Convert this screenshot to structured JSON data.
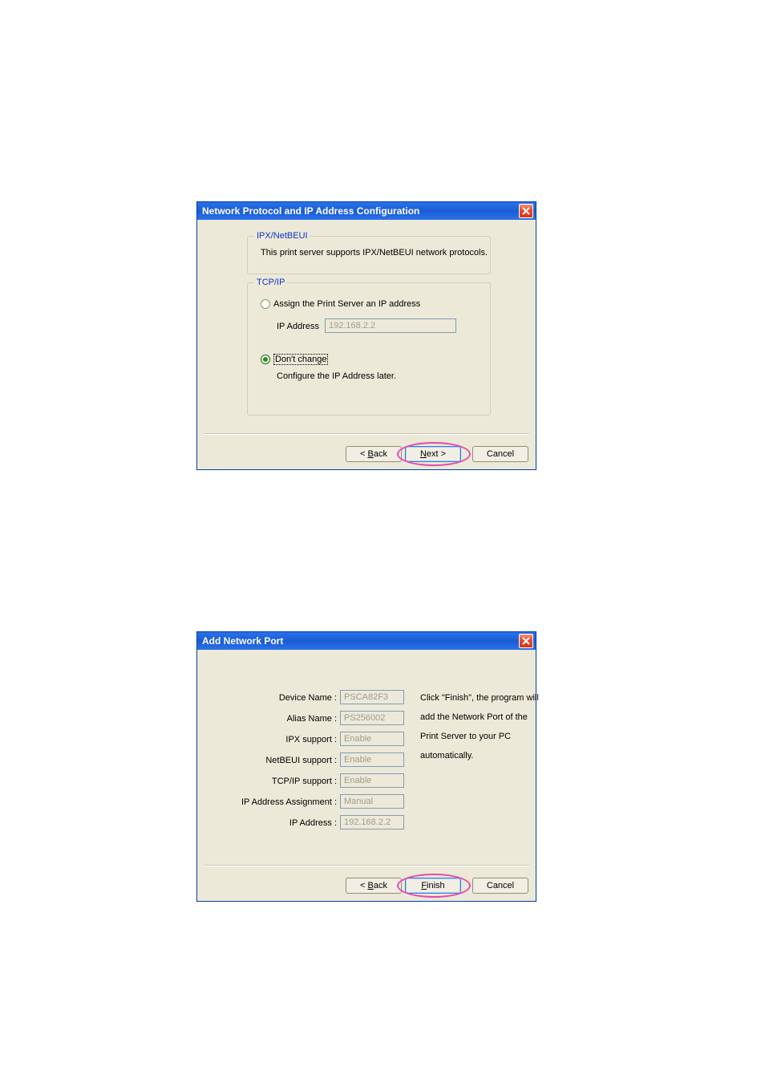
{
  "dialog1": {
    "title": "Network Protocol and IP Address Configuration",
    "ipxGroup": {
      "legend": "IPX/NetBEUI",
      "description": "This print server supports IPX/NetBEUI network protocols."
    },
    "tcpGroup": {
      "legend": "TCP/IP",
      "radioAssign": "Assign the Print Server an IP address",
      "ipLabel": "IP Address",
      "ipValue": "192.168.2.2",
      "radioDontChange": "Don't change",
      "configureLater": "Configure the IP Address later."
    },
    "buttons": {
      "back": "< Back",
      "backU": "B",
      "next": "Next >",
      "nextU": "N",
      "cancel": "Cancel"
    }
  },
  "dialog2": {
    "title": "Add Network Port",
    "form": {
      "deviceNameLabel": "Device Name :",
      "deviceNameValue": "PSCA82F3",
      "aliasNameLabel": "Alias Name :",
      "aliasNameValue": "PS256002",
      "ipxLabel": "IPX support :",
      "ipxValue": "Enable",
      "netbeuiLabel": "NetBEUI support :",
      "netbeuiValue": "Enable",
      "tcpipLabel": "TCP/IP support :",
      "tcpipValue": "Enable",
      "ipAssignLabel": "IP Address Assignment :",
      "ipAssignValue": "Manual",
      "ipAddrLabel": "IP Address :",
      "ipAddrValue": "192.168.2.2"
    },
    "info": "Click \"Finish\", the program will add the Network Port of the Print Server to your PC automatically.",
    "buttons": {
      "back": "< Back",
      "backU": "B",
      "finish": "Finish",
      "finishU": "F",
      "cancel": "Cancel"
    }
  }
}
